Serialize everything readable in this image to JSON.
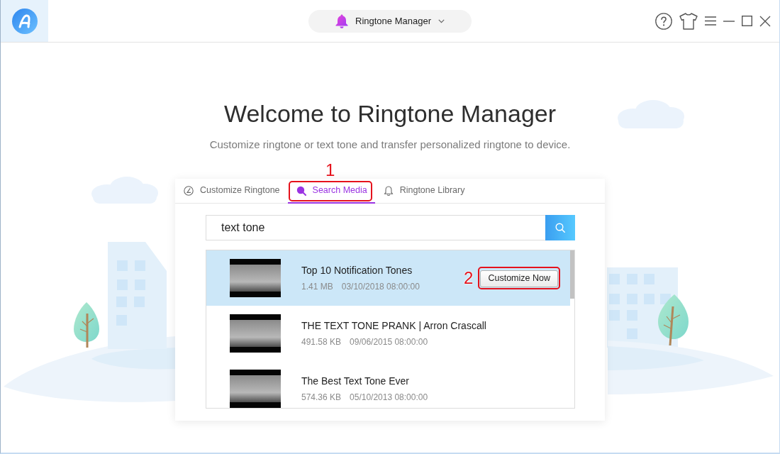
{
  "app_bar": {
    "title": "Ringtone Manager"
  },
  "welcome": {
    "title": "Welcome to Ringtone Manager",
    "subtitle": "Customize ringtone or text tone and transfer personalized ringtone to device."
  },
  "tabs": [
    {
      "label": "Customize Ringtone",
      "kind": "editor",
      "selected": false
    },
    {
      "label": "Search Media",
      "kind": "search",
      "selected": true,
      "callout": "1"
    },
    {
      "label": "Ringtone Library",
      "kind": "library",
      "selected": false
    }
  ],
  "search": {
    "value": "text tone"
  },
  "results": [
    {
      "title": "Top 10 Notification Tones",
      "size": "1.41 MB",
      "date": "03/10/2018 08:00:00",
      "selected": true,
      "action": {
        "label": "Customize Now",
        "callout": "2"
      }
    },
    {
      "title": "THE TEXT TONE PRANK | Arron Crascall",
      "size": "491.58 KB",
      "date": "09/06/2015 08:00:00",
      "selected": false
    },
    {
      "title": "The Best Text Tone Ever",
      "size": "574.36 KB",
      "date": "05/10/2013 08:00:00",
      "selected": false
    }
  ]
}
